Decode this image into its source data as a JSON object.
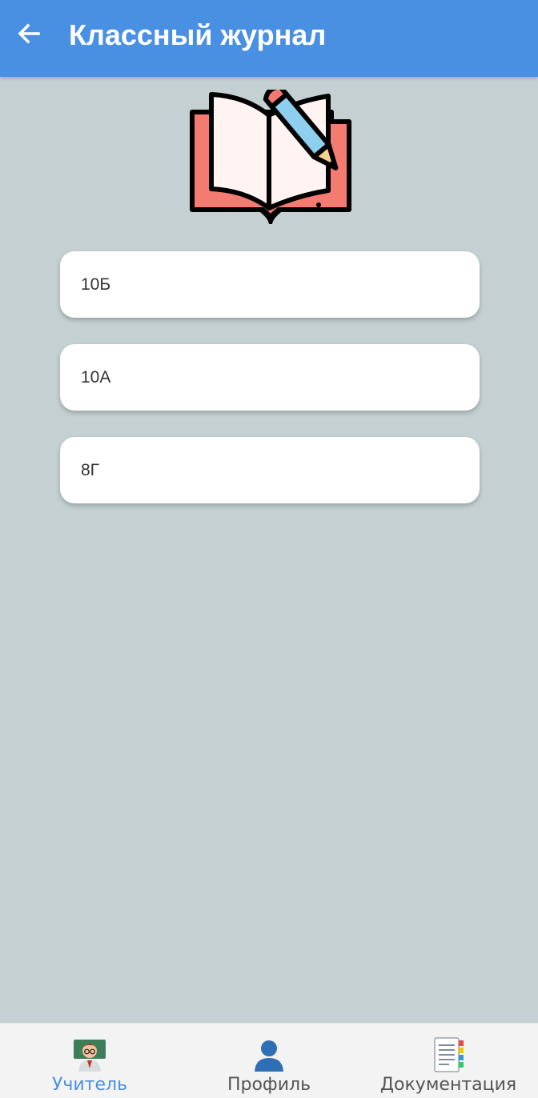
{
  "app_bar": {
    "title": "Классный журнал",
    "back_icon": "arrow-left-icon",
    "color": "#4a90e2"
  },
  "hero": {
    "icon": "open-book-with-pencil-icon"
  },
  "classes": [
    {
      "label": "10Б"
    },
    {
      "label": "10А"
    },
    {
      "label": "8Г"
    }
  ],
  "bottom_nav": {
    "items": [
      {
        "label": "Учитель",
        "icon": "teacher-icon",
        "active": true
      },
      {
        "label": "Профиль",
        "icon": "user-silhouette-icon",
        "active": false
      },
      {
        "label": "Документация",
        "icon": "document-icon",
        "active": false
      }
    ],
    "active_color": "#4a90e2"
  },
  "background_color": "#c4d0d1"
}
